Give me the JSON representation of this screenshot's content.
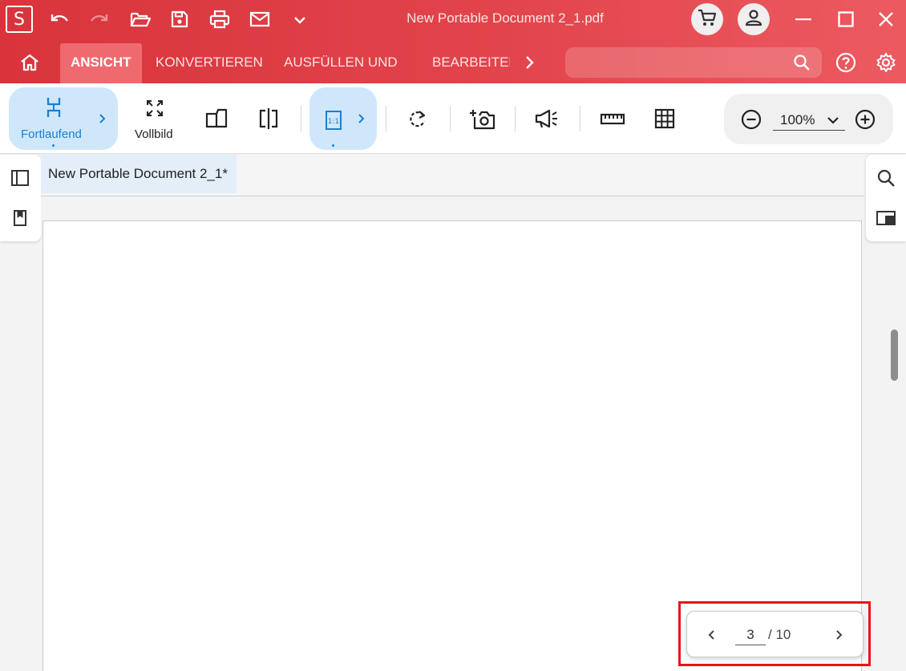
{
  "titlebar": {
    "app_logo": "S",
    "window_title": "New Portable Document 2_1.pdf",
    "accent_color": "#e2444b",
    "quick_icons": [
      "undo-icon",
      "redo-icon",
      "open-folder-icon",
      "save-icon",
      "print-icon",
      "mail-icon",
      "chevron-down-icon"
    ],
    "right_icons": [
      "cart-icon",
      "user-icon",
      "minimize-icon",
      "maximize-icon",
      "close-icon"
    ]
  },
  "ribbon": {
    "tabs": [
      {
        "label": "ANSICHT",
        "active": true
      },
      {
        "label": "KONVERTIEREN",
        "active": false
      },
      {
        "label": "AUSFÜLLEN UND",
        "active": false
      },
      {
        "label": "BEARBEITEN",
        "active": false
      }
    ],
    "search": {
      "placeholder": ""
    },
    "icons": [
      "home-icon",
      "chevron-right-icon",
      "search-icon",
      "help-icon",
      "settings-icon"
    ]
  },
  "toolbar": {
    "continuous_label": "Fortlaufend",
    "fullscreen_label": "Vollbild",
    "actual_size_icon_text": "1:1",
    "zoom_value": "100%",
    "selected_color": "#cfe7fb",
    "icons": [
      "continuous-scroll-icon",
      "fullscreen-icon",
      "two-page-icon",
      "split-view-icon",
      "actual-size-icon",
      "rotate-icon",
      "snapshot-icon",
      "read-aloud-icon",
      "ruler-icon",
      "grid-icon",
      "zoom-out-icon",
      "zoom-in-icon"
    ]
  },
  "document": {
    "tab_label": "New Portable Document 2_1*",
    "current_page": "3",
    "total_pages": "/ 10"
  },
  "side_panels": {
    "left_icons": [
      "sidebar-panel-icon",
      "bookmark-icon"
    ],
    "right_icons": [
      "search-icon",
      "panel-toggle-icon"
    ]
  }
}
